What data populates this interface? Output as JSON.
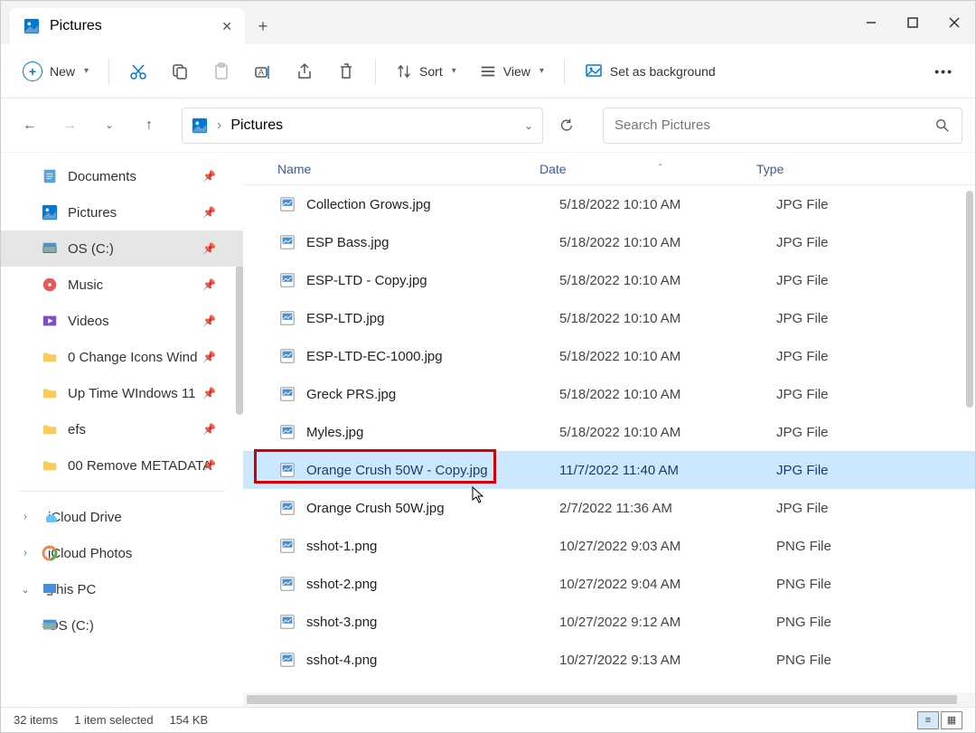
{
  "tab": {
    "title": "Pictures"
  },
  "toolbar": {
    "new": "New",
    "sort": "Sort",
    "view": "View",
    "background": "Set as background"
  },
  "breadcrumb": {
    "location": "Pictures"
  },
  "search": {
    "placeholder": "Search Pictures"
  },
  "sidebar": {
    "quick": [
      {
        "label": "Documents",
        "icon": "doc"
      },
      {
        "label": "Pictures",
        "icon": "pic"
      },
      {
        "label": "OS (C:)",
        "icon": "drive",
        "selected": true
      },
      {
        "label": "Music",
        "icon": "music"
      },
      {
        "label": "Videos",
        "icon": "video"
      },
      {
        "label": "0 Change Icons Wind",
        "icon": "folder",
        "pin": true
      },
      {
        "label": "Up Time WIndows 11",
        "icon": "folder"
      },
      {
        "label": "efs",
        "icon": "folder"
      },
      {
        "label": "00 Remove METADATA",
        "icon": "folder"
      }
    ],
    "cloud": [
      {
        "label": "iCloud Drive",
        "exp": ">"
      },
      {
        "label": "iCloud Photos",
        "exp": ">"
      },
      {
        "label": "This PC",
        "exp": "v"
      },
      {
        "label": "OS (C:)",
        "exp": ">",
        "sub": true
      }
    ]
  },
  "columns": {
    "name": "Name",
    "date": "Date",
    "type": "Type"
  },
  "files": [
    {
      "name": "Collection Grows.jpg",
      "date": "5/18/2022 10:10 AM",
      "type": "JPG File",
      "ic": "img"
    },
    {
      "name": "ESP Bass.jpg",
      "date": "5/18/2022 10:10 AM",
      "type": "JPG File",
      "ic": "img"
    },
    {
      "name": "ESP-LTD - Copy.jpg",
      "date": "5/18/2022 10:10 AM",
      "type": "JPG File",
      "ic": "img"
    },
    {
      "name": "ESP-LTD.jpg",
      "date": "5/18/2022 10:10 AM",
      "type": "JPG File",
      "ic": "img"
    },
    {
      "name": "ESP-LTD-EC-1000.jpg",
      "date": "5/18/2022 10:10 AM",
      "type": "JPG File",
      "ic": "img"
    },
    {
      "name": "Greck PRS.jpg",
      "date": "5/18/2022 10:10 AM",
      "type": "JPG File",
      "ic": "img"
    },
    {
      "name": "Myles.jpg",
      "date": "5/18/2022 10:10 AM",
      "type": "JPG File",
      "ic": "img"
    },
    {
      "name": "Orange Crush 50W - Copy.jpg",
      "date": "11/7/2022 11:40 AM",
      "type": "JPG File",
      "ic": "img",
      "selected": true,
      "highlight": true
    },
    {
      "name": "Orange Crush 50W.jpg",
      "date": "2/7/2022 11:36 AM",
      "type": "JPG File",
      "ic": "img"
    },
    {
      "name": "sshot-1.png",
      "date": "10/27/2022 9:03 AM",
      "type": "PNG File",
      "ic": "img"
    },
    {
      "name": "sshot-2.png",
      "date": "10/27/2022 9:04 AM",
      "type": "PNG File",
      "ic": "img"
    },
    {
      "name": "sshot-3.png",
      "date": "10/27/2022 9:12 AM",
      "type": "PNG File",
      "ic": "img"
    },
    {
      "name": "sshot-4.png",
      "date": "10/27/2022 9:13 AM",
      "type": "PNG File",
      "ic": "img"
    }
  ],
  "status": {
    "count": "32 items",
    "selection": "1 item selected",
    "size": "154 KB"
  }
}
